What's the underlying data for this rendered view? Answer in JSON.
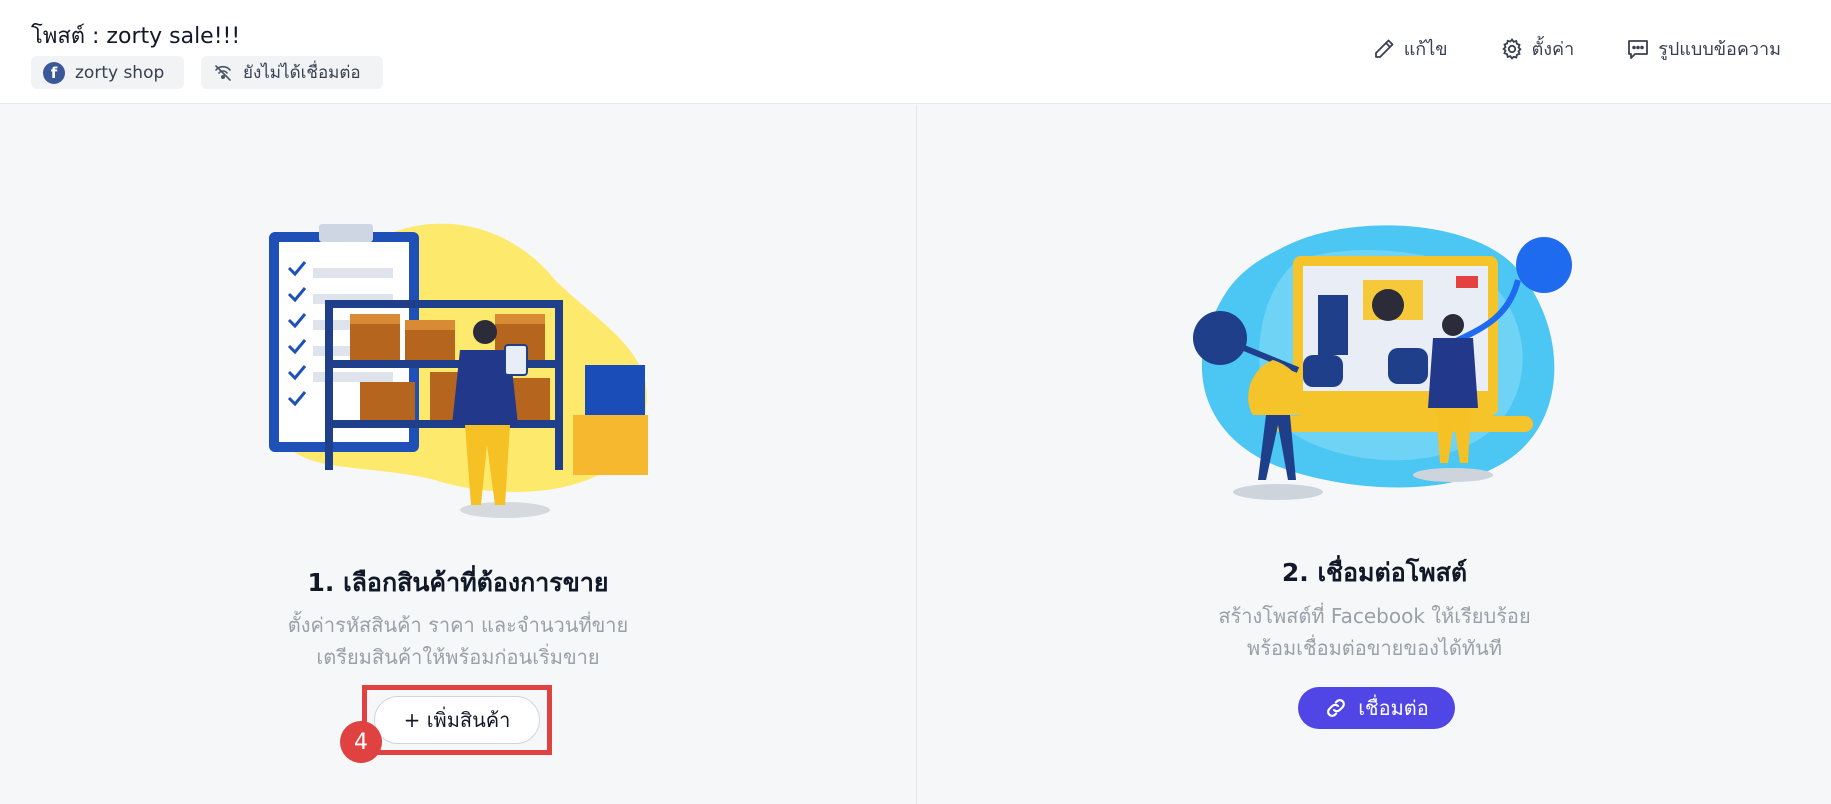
{
  "header": {
    "post_title": "โพสต์ : zorty sale!!!",
    "shop_chip": "zorty shop",
    "status_chip": "ยังไม่ได้เชื่อมต่อ",
    "actions": {
      "edit": "แก้ไข",
      "settings": "ตั้งค่า",
      "message_format": "รูปแบบข้อความ"
    }
  },
  "step1": {
    "title": "1. เลือกสินค้าที่ต้องการขาย",
    "desc_line1": "ตั้งค่ารหัสสินค้า ราคา และจำนวนที่ขาย",
    "desc_line2": "เตรียมสินค้าให้พร้อมก่อนเริ่มขาย",
    "button": "+ เพิ่มสินค้า",
    "annotation_number": "4"
  },
  "step2": {
    "title": "2. เชื่อมต่อโพสต์",
    "desc_line1": "สร้างโพสต์ที่ Facebook ให้เรียบร้อย",
    "desc_line2": "พร้อมเชื่อมต่อขายของได้ทันที",
    "button": "เชื่อมต่อ"
  },
  "icons": {
    "facebook": "facebook-icon",
    "disconnected": "disconnected-icon",
    "edit": "pencil-icon",
    "settings": "gear-icon",
    "message": "chat-bubble-icon",
    "link": "link-icon"
  },
  "colors": {
    "primary": "#4f46e5",
    "highlight": "#e04242",
    "facebook": "#3b5998"
  }
}
